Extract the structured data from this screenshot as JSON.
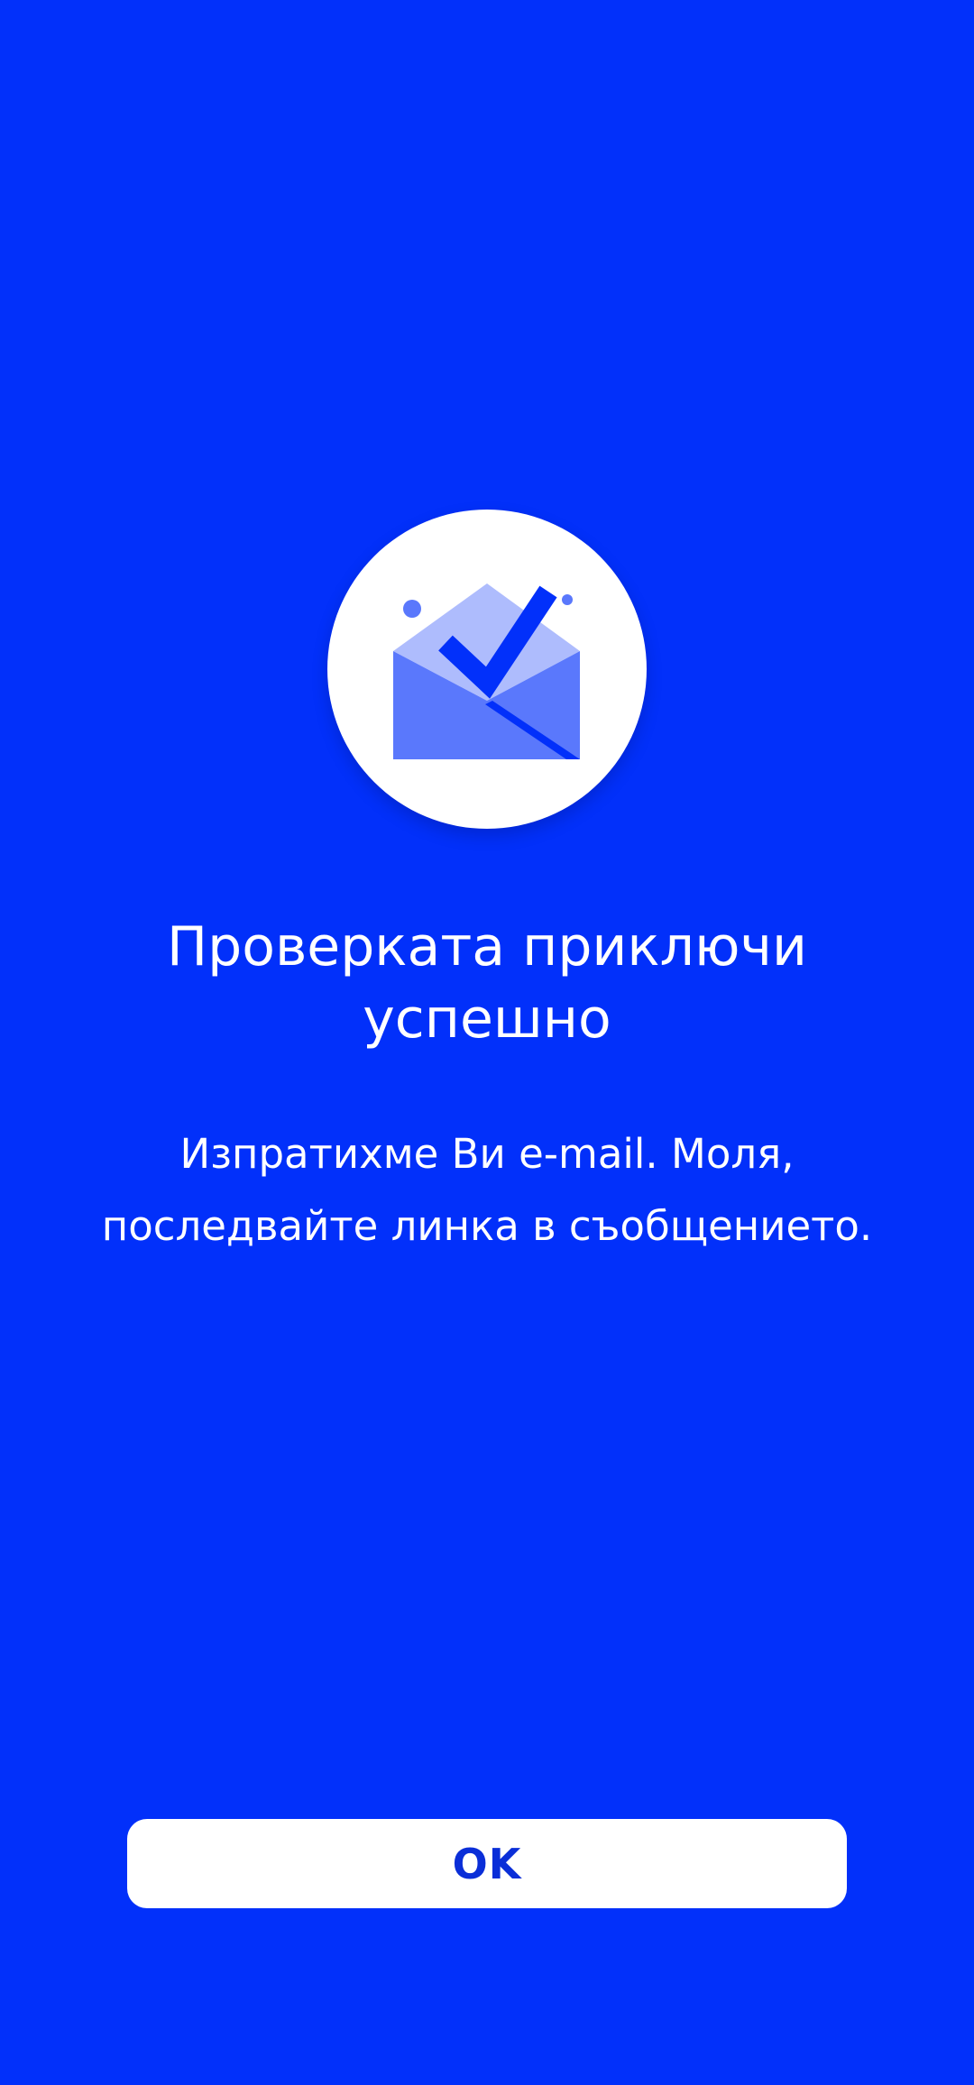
{
  "screen": {
    "illustration_icon": "envelope-check-icon"
  },
  "content": {
    "title": "Проверката приключи успешно",
    "message": "Изпратихме Ви e-mail. Моля, последвайте линка в съобщението."
  },
  "actions": {
    "ok_label": "OK"
  },
  "colors": {
    "background": "#0230fa",
    "text": "#ffffff",
    "button_background": "#ffffff",
    "button_text": "#0a2ed8",
    "envelope_body": "#5a78fc",
    "envelope_flap": "#aebcfd",
    "checkmark": "#0230fa"
  }
}
